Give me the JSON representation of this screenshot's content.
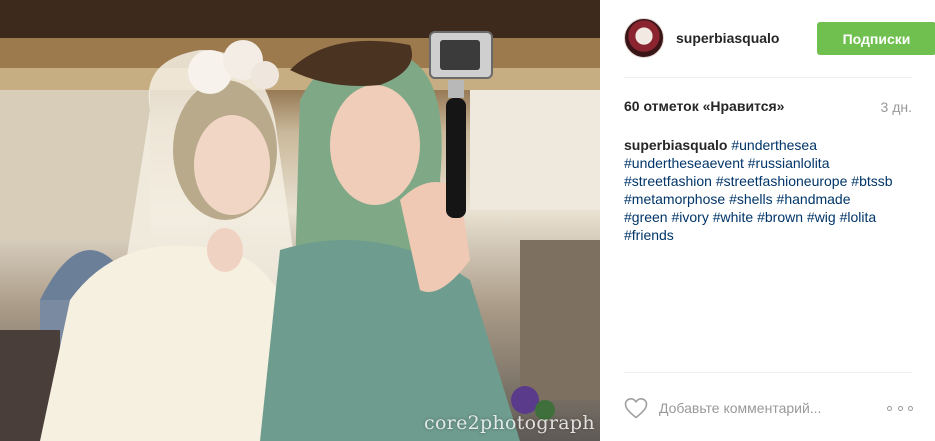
{
  "photo": {
    "alt_semantic": "two-cosplayers-selfie-photo",
    "watermark": "core2photograph"
  },
  "header": {
    "username": "superbiasqualo",
    "follow_label": "Подписки"
  },
  "meta": {
    "likes": "60 отметок «Нравится»",
    "time_ago": "3 дн."
  },
  "caption": {
    "username": "superbiasqualo",
    "hashtags": [
      "#undertheseа",
      "#undertheseaevent",
      "#russianlolita",
      "#streetfashion",
      "#streetfashioneurope",
      "#btssb",
      "#metamorphose",
      "#shells",
      "#handmade",
      "#green",
      "#ivory",
      "#white",
      "#brown",
      "#wig",
      "#lolita",
      "#friends"
    ]
  },
  "comment": {
    "placeholder": "Добавьте комментарий...",
    "like_icon": "heart-outline-icon",
    "more_icon": "more-options-icon"
  },
  "colors": {
    "follow_button": "#70c050",
    "hashtag": "#003569",
    "muted_text": "#999999",
    "divider": "#efefef"
  }
}
